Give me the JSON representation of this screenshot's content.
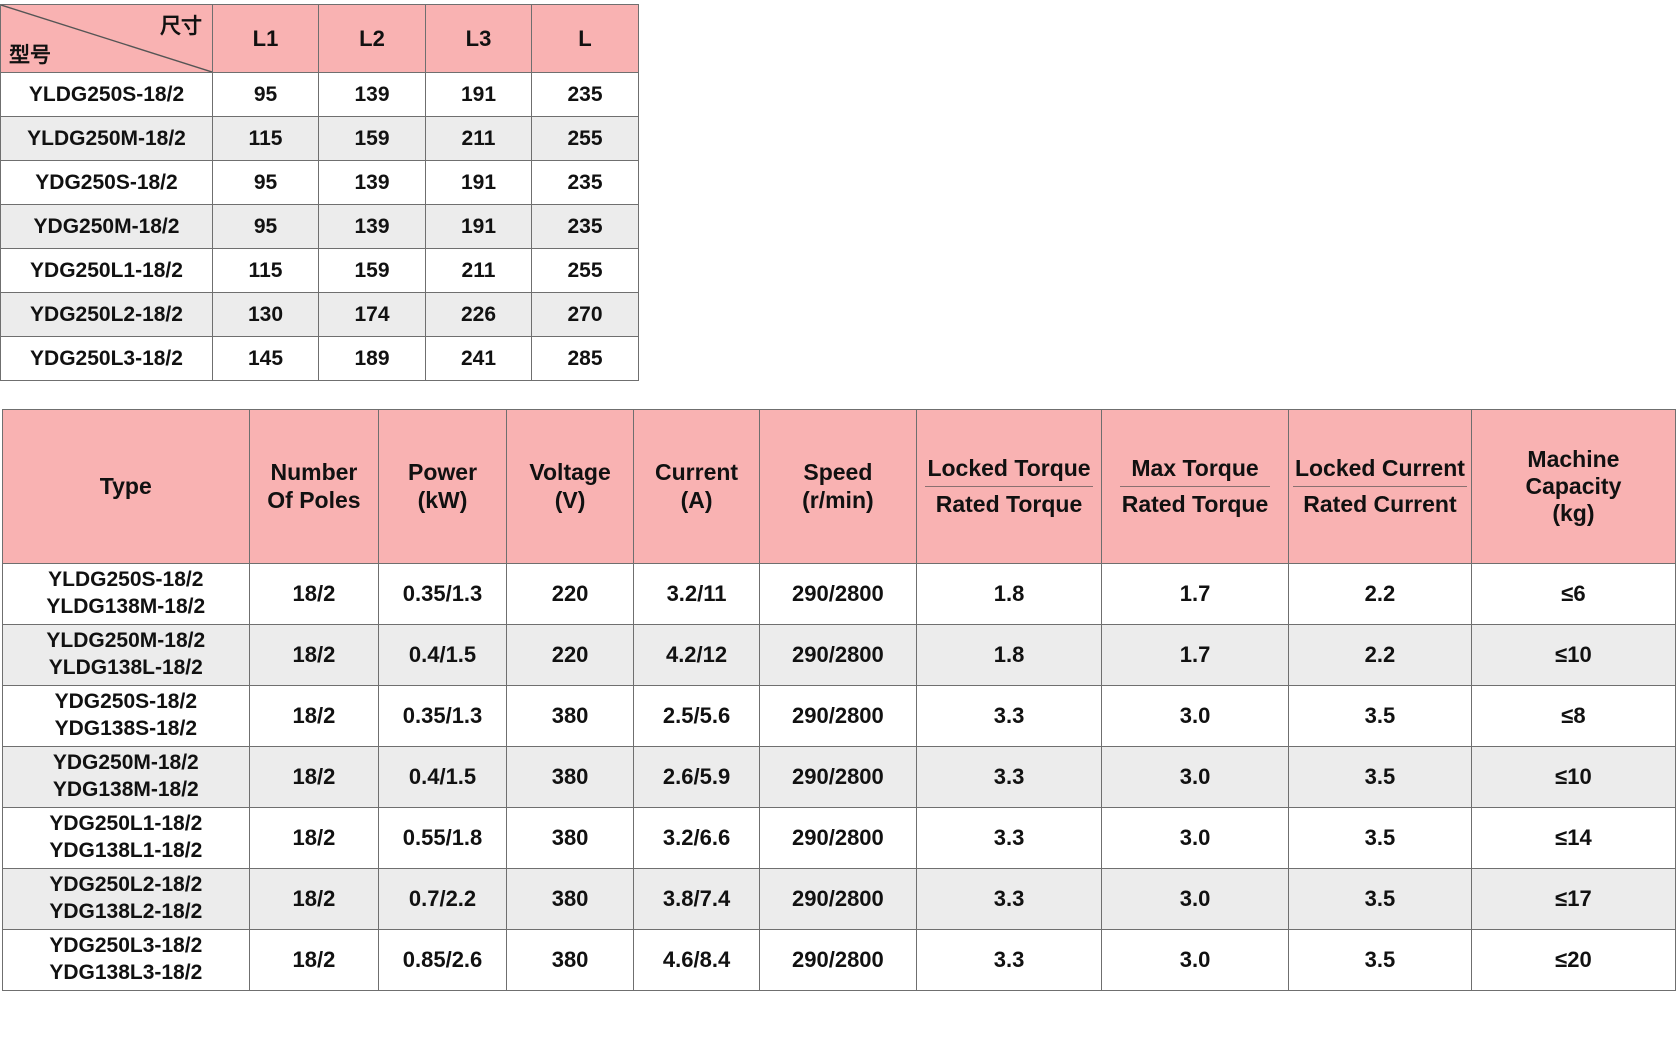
{
  "dimension_table": {
    "corner": {
      "top_right_label": "尺寸",
      "bottom_left_label": "型号"
    },
    "columns": [
      "L1",
      "L2",
      "L3",
      "L"
    ],
    "rows": [
      {
        "model": "YLDG250S-18/2",
        "L1": "95",
        "L2": "139",
        "L3": "191",
        "L": "235"
      },
      {
        "model": "YLDG250M-18/2",
        "L1": "115",
        "L2": "159",
        "L3": "211",
        "L": "255"
      },
      {
        "model": "YDG250S-18/2",
        "L1": "95",
        "L2": "139",
        "L3": "191",
        "L": "235"
      },
      {
        "model": "YDG250M-18/2",
        "L1": "95",
        "L2": "139",
        "L3": "191",
        "L": "235"
      },
      {
        "model": "YDG250L1-18/2",
        "L1": "115",
        "L2": "159",
        "L3": "211",
        "L": "255"
      },
      {
        "model": "YDG250L2-18/2",
        "L1": "130",
        "L2": "174",
        "L3": "226",
        "L": "270"
      },
      {
        "model": "YDG250L3-18/2",
        "L1": "145",
        "L2": "189",
        "L3": "241",
        "L": "285"
      }
    ]
  },
  "spec_table": {
    "headers": {
      "type": "Type",
      "poles_line1": "Number",
      "poles_line2": "Of Poles",
      "power_line1": "Power",
      "power_line2": "(kW)",
      "voltage_line1": "Voltage",
      "voltage_line2": "(V)",
      "current_line1": "Current",
      "current_line2": "(A)",
      "speed_line1": "Speed",
      "speed_line2": "(r/min)",
      "locked_torque_num": "Locked Torque",
      "locked_torque_den": "Rated Torque",
      "max_torque_num": "Max Torque",
      "max_torque_den": "Rated Torque",
      "locked_current_num": "Locked Current",
      "locked_current_den": "Rated Current",
      "capacity_line1": "Machine",
      "capacity_line2": "Capacity",
      "capacity_line3": "(kg)"
    },
    "rows": [
      {
        "type_line1": "YLDG250S-18/2",
        "type_line2": "YLDG138M-18/2",
        "poles": "18/2",
        "power": "0.35/1.3",
        "voltage": "220",
        "current": "3.2/11",
        "speed": "290/2800",
        "locked_torque": "1.8",
        "max_torque": "1.7",
        "locked_current": "2.2",
        "capacity": "≤6"
      },
      {
        "type_line1": "YLDG250M-18/2",
        "type_line2": "YLDG138L-18/2",
        "poles": "18/2",
        "power": "0.4/1.5",
        "voltage": "220",
        "current": "4.2/12",
        "speed": "290/2800",
        "locked_torque": "1.8",
        "max_torque": "1.7",
        "locked_current": "2.2",
        "capacity": "≤10"
      },
      {
        "type_line1": "YDG250S-18/2",
        "type_line2": "YDG138S-18/2",
        "poles": "18/2",
        "power": "0.35/1.3",
        "voltage": "380",
        "current": "2.5/5.6",
        "speed": "290/2800",
        "locked_torque": "3.3",
        "max_torque": "3.0",
        "locked_current": "3.5",
        "capacity": "≤8"
      },
      {
        "type_line1": "YDG250M-18/2",
        "type_line2": "YDG138M-18/2",
        "poles": "18/2",
        "power": "0.4/1.5",
        "voltage": "380",
        "current": "2.6/5.9",
        "speed": "290/2800",
        "locked_torque": "3.3",
        "max_torque": "3.0",
        "locked_current": "3.5",
        "capacity": "≤10"
      },
      {
        "type_line1": "YDG250L1-18/2",
        "type_line2": "YDG138L1-18/2",
        "poles": "18/2",
        "power": "0.55/1.8",
        "voltage": "380",
        "current": "3.2/6.6",
        "speed": "290/2800",
        "locked_torque": "3.3",
        "max_torque": "3.0",
        "locked_current": "3.5",
        "capacity": "≤14"
      },
      {
        "type_line1": "YDG250L2-18/2",
        "type_line2": "YDG138L2-18/2",
        "poles": "18/2",
        "power": "0.7/2.2",
        "voltage": "380",
        "current": "3.8/7.4",
        "speed": "290/2800",
        "locked_torque": "3.3",
        "max_torque": "3.0",
        "locked_current": "3.5",
        "capacity": "≤17"
      },
      {
        "type_line1": "YDG250L3-18/2",
        "type_line2": "YDG138L3-18/2",
        "poles": "18/2",
        "power": "0.85/2.6",
        "voltage": "380",
        "current": "4.6/8.4",
        "speed": "290/2800",
        "locked_torque": "3.3",
        "max_torque": "3.0",
        "locked_current": "3.5",
        "capacity": "≤20"
      }
    ]
  },
  "colors": {
    "header_pink": "#f9b2b2",
    "row_stripe": "#ececec",
    "border": "#6f6f6f"
  }
}
